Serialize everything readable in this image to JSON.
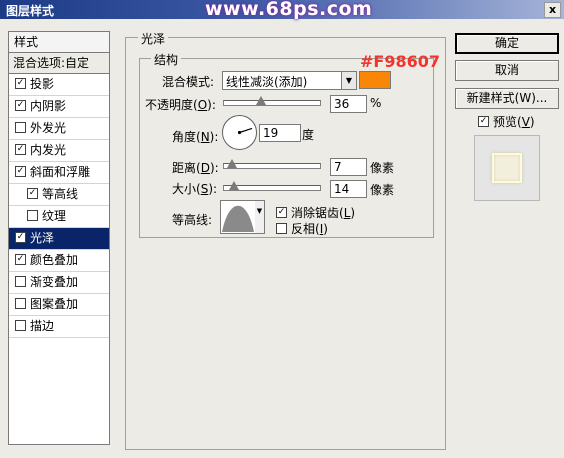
{
  "window": {
    "title": "图层样式",
    "watermark": "www.68ps.com",
    "close_glyph": "x"
  },
  "sidebar": {
    "header": "样式",
    "blend_options": "混合选项:自定",
    "items": [
      {
        "label": "投影",
        "checked": true,
        "active": false,
        "sub": false
      },
      {
        "label": "内阴影",
        "checked": true,
        "active": false,
        "sub": false
      },
      {
        "label": "外发光",
        "checked": false,
        "active": false,
        "sub": false
      },
      {
        "label": "内发光",
        "checked": true,
        "active": false,
        "sub": false
      },
      {
        "label": "斜面和浮雕",
        "checked": true,
        "active": false,
        "sub": false
      },
      {
        "label": "等高线",
        "checked": true,
        "active": false,
        "sub": true
      },
      {
        "label": "纹理",
        "checked": false,
        "active": false,
        "sub": true
      },
      {
        "label": "光泽",
        "checked": true,
        "active": true,
        "sub": false
      },
      {
        "label": "颜色叠加",
        "checked": true,
        "active": false,
        "sub": false
      },
      {
        "label": "渐变叠加",
        "checked": false,
        "active": false,
        "sub": false
      },
      {
        "label": "图案叠加",
        "checked": false,
        "active": false,
        "sub": false
      },
      {
        "label": "描边",
        "checked": false,
        "active": false,
        "sub": false
      }
    ]
  },
  "satin": {
    "section_title": "光泽",
    "structure_title": "结构",
    "blend_mode_label": "混合模式:",
    "blend_mode_value": "线性减淡(添加)",
    "color_hex_annotation": "#F98607",
    "color": "#f98607",
    "opacity_label": "不透明度(",
    "opacity_key": "O",
    "opacity_label_end": "):",
    "opacity_value": "36",
    "opacity_unit": "%",
    "opacity_fraction": 0.36,
    "angle_label": "角度(",
    "angle_key": "N",
    "angle_label_end": "):",
    "angle_value": "19",
    "angle_unit": "度",
    "distance_label": "距离(",
    "distance_key": "D",
    "distance_label_end": "):",
    "distance_value": "7",
    "distance_unit": "像素",
    "distance_fraction": 0.03,
    "size_label": "大小(",
    "size_key": "S",
    "size_label_end": "):",
    "size_value": "14",
    "size_unit": "像素",
    "size_fraction": 0.06,
    "contour_label": "等高线:",
    "antialias_label": "消除锯齿(",
    "antialias_key": "L",
    "antialias_label_end": ")",
    "antialias_checked": true,
    "invert_label": "反相(",
    "invert_key": "I",
    "invert_label_end": ")",
    "invert_checked": false
  },
  "buttons": {
    "ok": "确定",
    "cancel": "取消",
    "new_style": "新建样式(W)...",
    "preview_label": "预览(",
    "preview_key": "V",
    "preview_label_end": ")",
    "preview_checked": true
  },
  "icons": {
    "check": "✓",
    "dropdown": "▼"
  }
}
